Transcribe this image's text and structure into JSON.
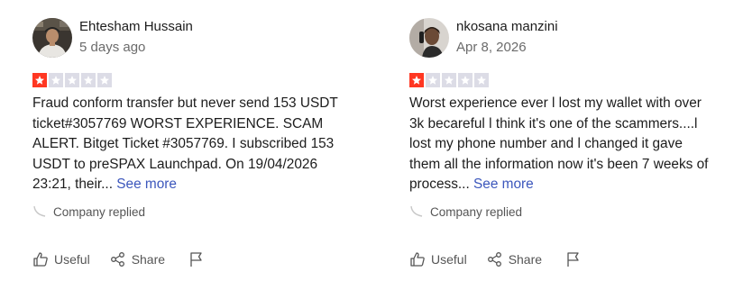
{
  "colors": {
    "star_filled": "#ff3722",
    "star_empty": "#dcdce6",
    "link": "#3c57bc",
    "muted": "#6b6b6b"
  },
  "reviews": [
    {
      "author": "Ehtesham Hussain",
      "date": "5 days ago",
      "rating": 1,
      "rating_max": 5,
      "text": "Fraud conform transfer but never send 153 USDT ticket#3057769 WORST EXPERIENCE. SCAM ALERT. Bitget Ticket #3057769. I subscribed 153 USDT to preSPAX Launchpad. On 19/04/2026 23:21, their...",
      "see_more": "See more",
      "company_replied": "Company replied",
      "useful_label": "Useful",
      "share_label": "Share",
      "avatar_icon": "user-avatar"
    },
    {
      "author": "nkosana manzini",
      "date": "Apr 8, 2026",
      "rating": 1,
      "rating_max": 5,
      "text": "Worst experience ever l lost my wallet with over 3k becareful l think it's one of the scammers....l lost my phone number and l changed it gave them all the information now it's been 7 weeks of process...",
      "see_more": "See more",
      "company_replied": "Company replied",
      "useful_label": "Useful",
      "share_label": "Share",
      "avatar_icon": "user-avatar"
    }
  ]
}
